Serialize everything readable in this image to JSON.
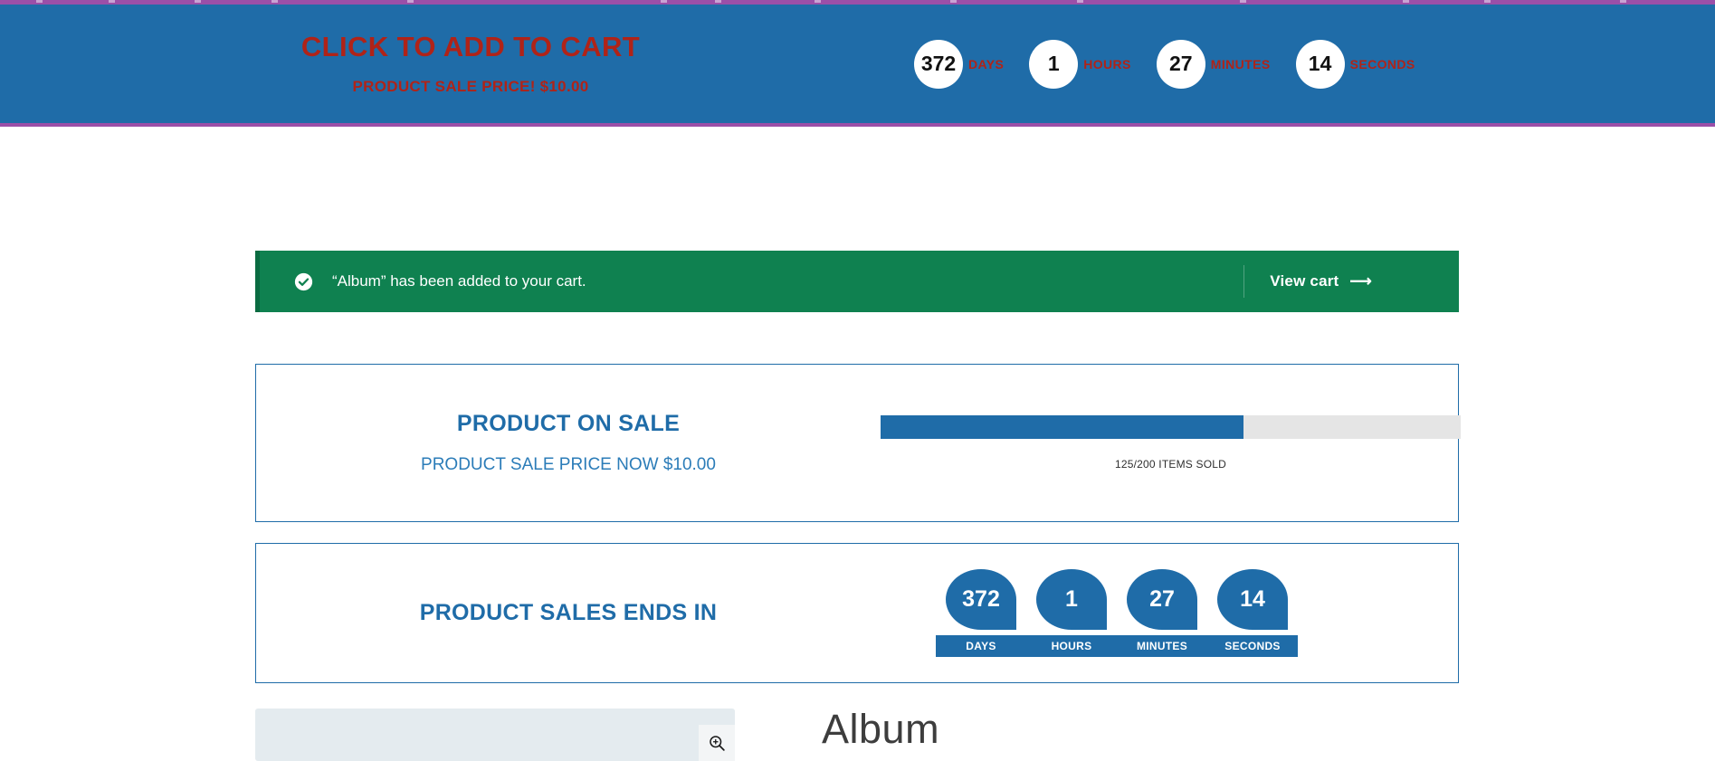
{
  "promo_banner": {
    "headline": "CLICK TO ADD TO CART",
    "subline": "PRODUCT SALE PRICE! $10.00",
    "accent_color": "#1f6ca8",
    "text_color": "#b02318",
    "countdown": [
      {
        "value": "372",
        "label": "DAYS"
      },
      {
        "value": "1",
        "label": "HOURS"
      },
      {
        "value": "27",
        "label": "MINUTES"
      },
      {
        "value": "14",
        "label": "SECONDS"
      }
    ]
  },
  "cart_notice": {
    "message": "“Album” has been added to your cart.",
    "view_cart_label": "View cart",
    "arrow": "⟶",
    "icon": "check-circle-icon",
    "background_color": "#0f8150"
  },
  "sale_panel": {
    "title": "PRODUCT ON SALE",
    "subtitle": "PRODUCT SALE PRICE NOW $10.00",
    "progress_caption": "125/200 ITEMS SOLD",
    "sold": 125,
    "total": 200,
    "percent": 62.5,
    "bar_fill_color": "#1f6ca8",
    "bar_track_color": "#e5e5e5"
  },
  "ends_panel": {
    "title": "PRODUCT SALES ENDS IN",
    "countdown": [
      {
        "value": "372",
        "label": "DAYS"
      },
      {
        "value": "1",
        "label": "HOURS"
      },
      {
        "value": "27",
        "label": "MINUTES"
      },
      {
        "value": "14",
        "label": "SECONDS"
      }
    ]
  },
  "product": {
    "title": "Album",
    "zoom_icon": "magnifier-plus-icon"
  }
}
